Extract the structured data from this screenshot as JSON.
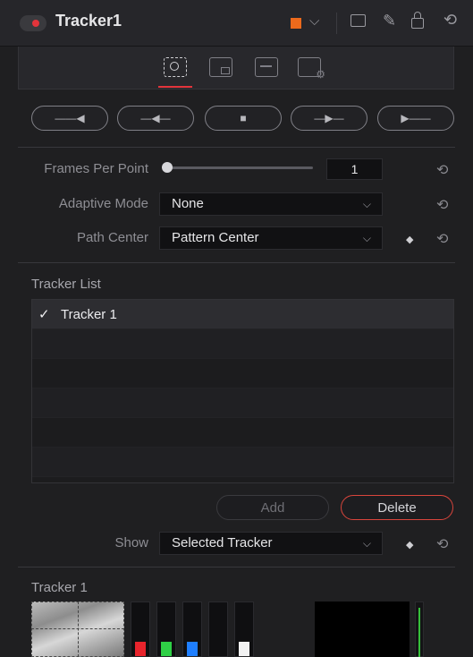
{
  "header": {
    "title": "Tracker1",
    "accent_color": "#ec6a1c",
    "icons": [
      "chevron-down-icon",
      "window-icon",
      "pin-icon",
      "lock-icon",
      "reset-icon"
    ]
  },
  "tool_tabs": [
    "tracker-tab-icon",
    "operation-tab-icon",
    "display-tab-icon",
    "settings-tab-icon"
  ],
  "transport": {
    "buttons": [
      "track-reverse-from-end",
      "track-reverse",
      "stop-tracking",
      "track-forward",
      "track-forward-from-start"
    ],
    "glyphs": [
      "——◀",
      "—◀—",
      "■",
      "—▶—",
      "▶——"
    ]
  },
  "frames_per_point": {
    "label": "Frames Per Point",
    "value": "1",
    "slider_fraction": 0.0
  },
  "adaptive_mode": {
    "label": "Adaptive Mode",
    "value": "None"
  },
  "path_center": {
    "label": "Path Center",
    "value": "Pattern Center"
  },
  "tracker_list": {
    "title": "Tracker List",
    "items": [
      {
        "label": "Tracker 1",
        "checked": true
      }
    ],
    "add_label": "Add",
    "delete_label": "Delete"
  },
  "show": {
    "label": "Show",
    "value": "Selected Tracker"
  },
  "tracker_section": {
    "title": "Tracker 1",
    "channel_colors": [
      "#e8242c",
      "#2fd046",
      "#1f7fff",
      "#2a2a2e",
      "#f2f2f2"
    ]
  },
  "glyphs": {
    "reset": "⟲",
    "chevron": "⌵",
    "diamond": "◆",
    "check": "✓"
  }
}
